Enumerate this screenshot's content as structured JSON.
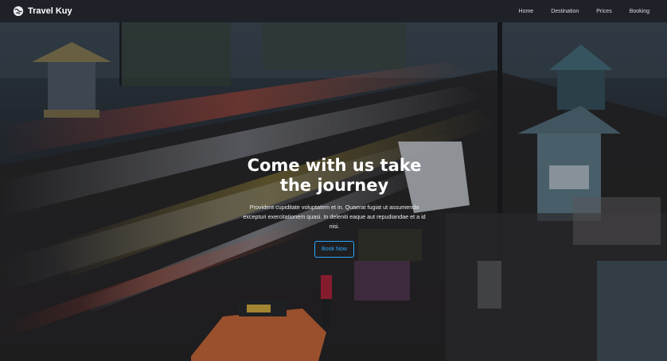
{
  "brand": {
    "name": "Travel Kuy",
    "icon": "globe-icon"
  },
  "nav": {
    "items": [
      {
        "label": "Home"
      },
      {
        "label": "Destination"
      },
      {
        "label": "Prices"
      },
      {
        "label": "Booking"
      }
    ]
  },
  "hero": {
    "title_line1": "Come with us take",
    "title_line2": "the journey",
    "description": "Provident cupiditate voluptatem et in. Quaerat fugiat ut assumenda excepturi exercitationem quasi. In deleniti eaque aut repudiandae et a id nisi.",
    "cta_label": "Book Now"
  },
  "colors": {
    "navbar_bg": "#1e2228",
    "accent": "#2aa7ff"
  }
}
